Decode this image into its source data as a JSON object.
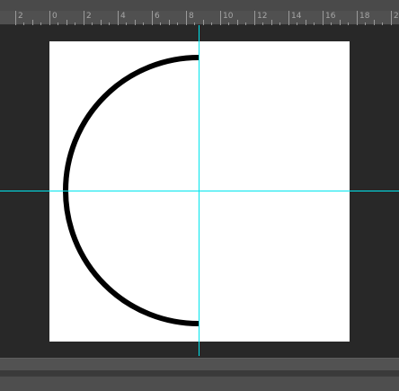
{
  "ruler": {
    "labels": [
      "2",
      "0",
      "2",
      "4",
      "6",
      "8",
      "10",
      "12",
      "14",
      "16",
      "18",
      "2"
    ]
  },
  "colors": {
    "workspace": "#282828",
    "canvas": "#ffffff",
    "guide": "#00e5ee",
    "stroke": "#000000"
  },
  "shape": {
    "type": "half-circle-arc",
    "side": "left"
  }
}
